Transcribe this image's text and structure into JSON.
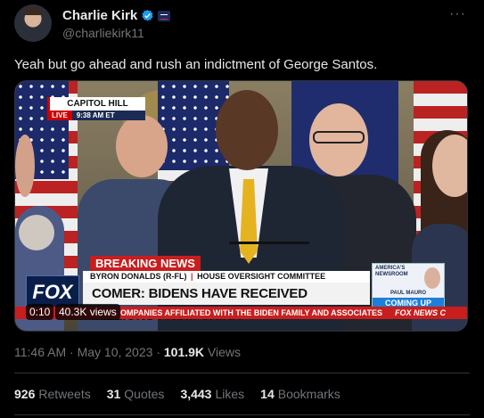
{
  "author": {
    "display_name": "Charlie Kirk",
    "handle": "@charliekirk11"
  },
  "tweet": {
    "text": "Yeah but go ahead and rush an indictment of George Santos."
  },
  "video": {
    "location_label": "CAPITOL HILL",
    "live_label": "LIVE",
    "live_time": "9:38 AM ET",
    "breaking_label": "BREAKING NEWS",
    "subtitle_name": "BYRON DONALDS (R-FL)",
    "subtitle_sep": "|",
    "subtitle_committee": "HOUSE OVERSIGHT COMMITTEE",
    "headline": "COMER: BIDENS HAVE RECEIVED MILLIONS FROM CHINA",
    "ticker": "OMPANIES AFFILIATED WITH THE BIDEN FAMILY AND ASSOCIATES",
    "ticker_brand": "FOX NEWS C",
    "channel_logo": "FOX",
    "promo_show": "AMERICA'S NEWSROOM",
    "promo_name": "PAUL MAURO",
    "promo_coming": "COMING UP",
    "elapsed": "0:10",
    "views": "40.3K views"
  },
  "meta": {
    "time": "11:46 AM",
    "dot1": "·",
    "date": "May 10, 2023",
    "dot2": "·",
    "views_count": "101.9K",
    "views_label": "Views"
  },
  "stats": {
    "retweets_count": "926",
    "retweets_label": "Retweets",
    "quotes_count": "31",
    "quotes_label": "Quotes",
    "likes_count": "3,443",
    "likes_label": "Likes",
    "bookmarks_count": "14",
    "bookmarks_label": "Bookmarks"
  },
  "colors": {
    "background": "#000000",
    "text_primary": "#e7e9ea",
    "text_secondary": "#71767b",
    "verified_blue": "#1d9bf0",
    "fox_red": "#c81e1e"
  },
  "icons": {
    "verified": "verified-badge-icon",
    "affiliate": "affiliate-badge-icon",
    "more": "more-dots-icon"
  }
}
